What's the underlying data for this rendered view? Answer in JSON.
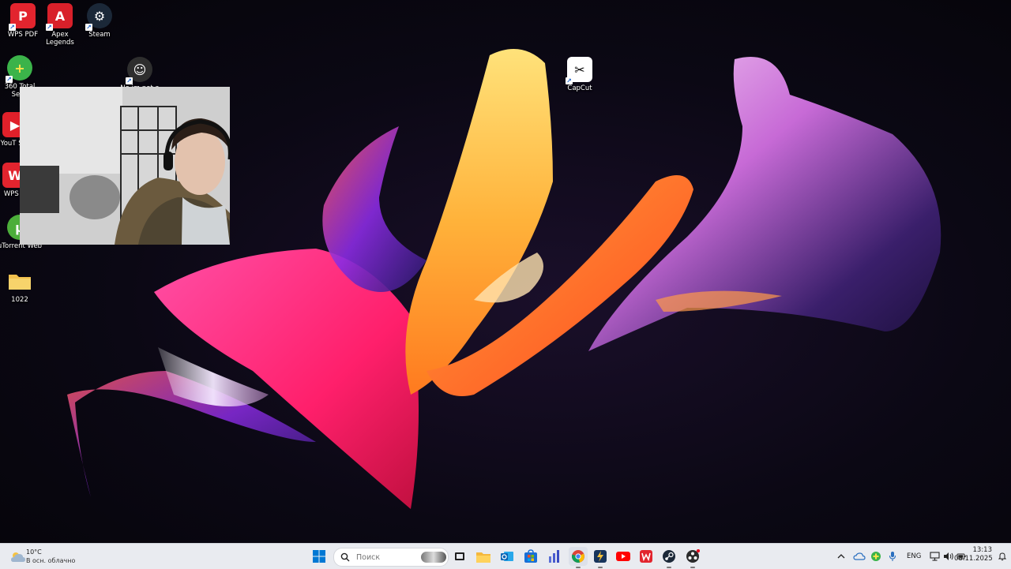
{
  "desktop": {
    "icons": [
      {
        "label": "WPS PDF",
        "color": "#e2242e",
        "glyph": "P"
      },
      {
        "label": "Apex Legends",
        "color": "#d8202a",
        "glyph": "A"
      },
      {
        "label": "Steam",
        "color": "#1b2838",
        "glyph": "S"
      },
      {
        "label": "360 Total Secu",
        "color": "#3bb34a",
        "glyph": "+"
      },
      {
        "label": "No im not a",
        "color": "#3a3a3a",
        "glyph": ""
      },
      {
        "label": "CapCut",
        "color": "#ffffff",
        "glyph": "X"
      },
      {
        "label": "YouT Stu",
        "color": "#e0202a",
        "glyph": "▶"
      },
      {
        "label": "WPS O",
        "color": "#e2242e",
        "glyph": "W"
      },
      {
        "label": "uTorrent Web",
        "color": "#4cae3a",
        "glyph": "µ"
      },
      {
        "label": "1022",
        "color": "#f2c14e",
        "glyph": ""
      }
    ]
  },
  "taskbar": {
    "weather": {
      "temp": "10°C",
      "desc": "В осн. облачно"
    },
    "search_placeholder": "Поиск",
    "language": "ENG",
    "time": "13:13",
    "date": "08.11.2025"
  },
  "colors": {
    "taskbar_bg": "#e9ebf0",
    "windows_blue": "#0078d4"
  }
}
